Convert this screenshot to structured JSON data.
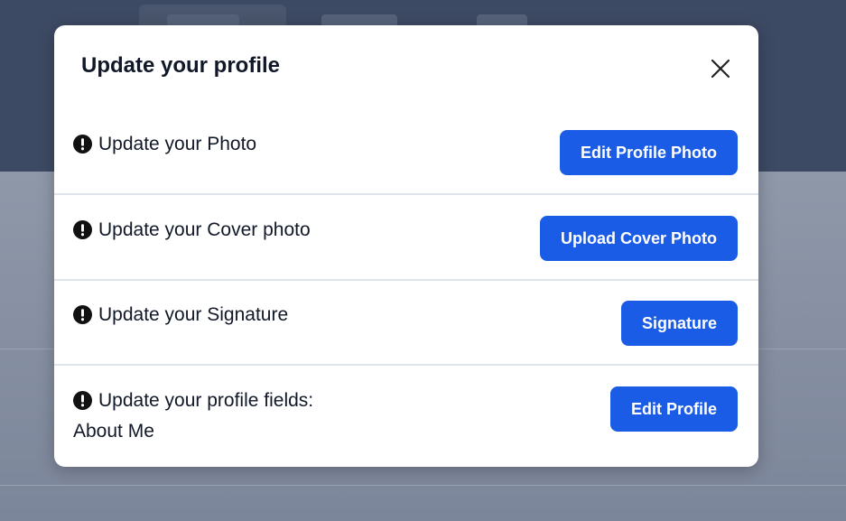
{
  "modal": {
    "title": "Update your profile",
    "close_icon": "close-icon",
    "rows": [
      {
        "label": "Update your Photo",
        "button": "Edit Profile Photo"
      },
      {
        "label": "Update your Cover photo",
        "button": "Upload Cover Photo"
      },
      {
        "label": "Update your Signature",
        "button": "Signature"
      },
      {
        "label": "Update your profile fields:",
        "sublabel": "About Me",
        "button": "Edit Profile"
      }
    ]
  },
  "colors": {
    "primary": "#1a5ce6",
    "backdrop": "#8e97a8",
    "header": "#3d4a63"
  }
}
